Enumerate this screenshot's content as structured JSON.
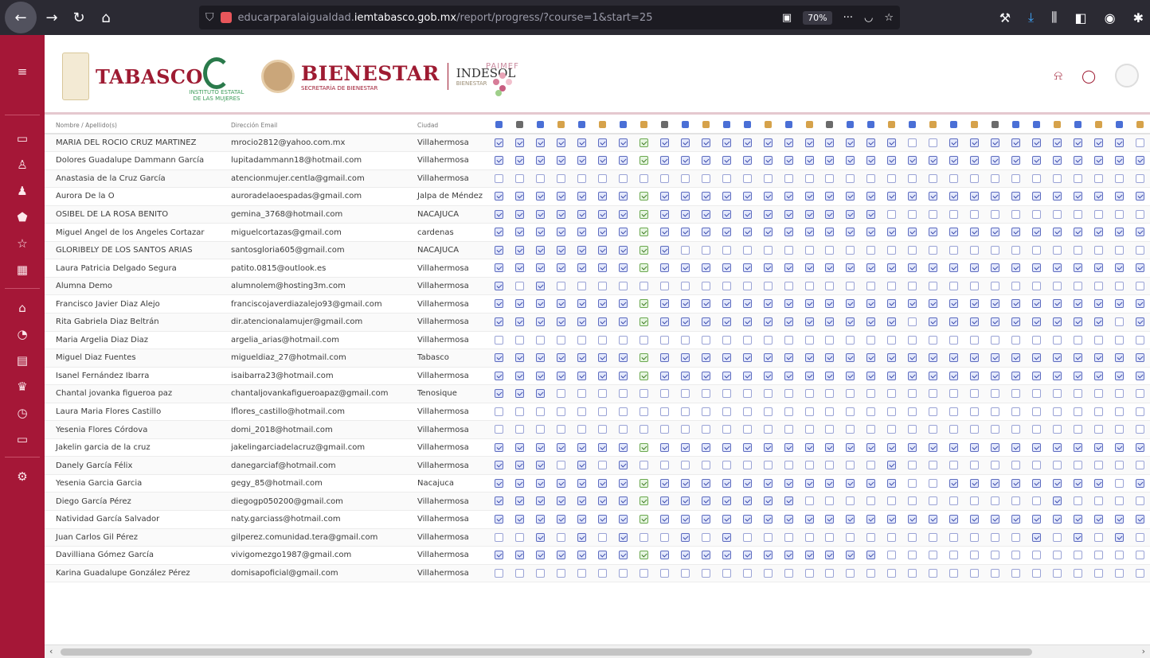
{
  "browser": {
    "url_prefix": "educarparalaigualdad.",
    "url_domain": "iemtabasco.gob.mx",
    "url_path": "/report/progress/?course=1&start=25",
    "zoom": "70%",
    "icons": [
      "back-icon",
      "forward-icon",
      "reload-icon",
      "home-icon",
      "shield-icon",
      "reader-icon",
      "more-icon",
      "pocket-icon",
      "star-icon",
      "wrench-icon",
      "download-icon",
      "library-icon",
      "sidebar-icon",
      "account-icon",
      "extension-icon"
    ]
  },
  "sidebar": {
    "icons": [
      "menu-icon",
      "folder-icon",
      "users-icon",
      "user-icon",
      "shield-icon",
      "star-icon",
      "calendar-icon",
      "home-icon",
      "dashboard-icon",
      "grid-icon",
      "badge-icon",
      "chart-icon",
      "folder-icon",
      "settings-icon"
    ]
  },
  "header": {
    "logo_tabasco": "TABASCO",
    "logo_iem_sub": "INSTITUTO ESTATAL DE LAS MUJERES",
    "logo_bienestar": "BIENESTAR",
    "logo_bienestar_sub": "SECRETARÍA DE BIENESTAR",
    "logo_indesol": "INDESOL",
    "logo_indesol_sub": "BIENESTAR",
    "logo_paimef": "PAIMEF",
    "actions": [
      "bell-icon",
      "chat-icon",
      "avatar"
    ]
  },
  "table": {
    "columns": {
      "name": "Nombre / Apellido(s)",
      "email": "Dirección Email",
      "city": "Ciudad"
    },
    "rows": [
      {
        "name": "MARIA DEL ROCIO CRUZ MARTINEZ",
        "email": "mrocio2812@yahoo.com.mx",
        "city": "Villahermosa",
        "p": "111111111111111111110011111111101111110"
      },
      {
        "name": "Dolores Guadalupe Dammann García",
        "email": "lupitadammann18@hotmail.com",
        "city": "Villahermosa",
        "p": "111111111111111111111111111111111111110"
      },
      {
        "name": "Anastasia de la Cruz García",
        "email": "atencionmujer.centla@gmail.com",
        "city": "Villahermosa",
        "p": "000000000000000000000000000000000000000"
      },
      {
        "name": "Aurora De la O",
        "email": "auroradelaoespadas@gmail.com",
        "city": "Jalpa de Méndez",
        "p": "111111111111111111111111111111111111110"
      },
      {
        "name": "OSIBEL DE LA ROSA BENITO",
        "email": "gemina_3768@hotmail.com",
        "city": "NACAJUCA",
        "p": "111111111111111111100000000000000000000"
      },
      {
        "name": "Miguel Angel de los Angeles Cortazar",
        "email": "miguelcortazas@gmail.com",
        "city": "cardenas",
        "p": "111111111111111111111111111111111111110"
      },
      {
        "name": "GLORIBELY DE LOS SANTOS ARIAS",
        "email": "santosgloria605@gmail.com",
        "city": "NACAJUCA",
        "p": "111111111000000000000000000000000000000"
      },
      {
        "name": "Laura Patricia Delgado Segura",
        "email": "patito.0815@outlook.es",
        "city": "Villahermosa",
        "p": "111111111111111111111111111111111111110"
      },
      {
        "name": "Alumna Demo",
        "email": "alumnolem@hosting3m.com",
        "city": "Villahermosa",
        "p": "101000000000000000000000000000000000000"
      },
      {
        "name": "Francisco Javier Diaz Alejo",
        "email": "franciscojaverdiazalejo93@gmail.com",
        "city": "Villahermosa",
        "p": "111111111111111111111111111111111111110"
      },
      {
        "name": "Rita Gabriela Diaz Beltrán",
        "email": "dir.atencionalamujer@gmail.com",
        "city": "Villahermosa",
        "p": "111111111111111111110111111111011111110"
      },
      {
        "name": "Maria Argelia Diaz Diaz",
        "email": "argelia_arias@hotmail.com",
        "city": "Villahermosa",
        "p": "000000000000000000000000000000000000000"
      },
      {
        "name": "Miguel Diaz Fuentes",
        "email": "migueldiaz_27@hotmail.com",
        "city": "Tabasco",
        "p": "111111111111111111111111111111111111110"
      },
      {
        "name": "Isanel Fernández Ibarra",
        "email": "isaibarra23@hotmail.com",
        "city": "Villahermosa",
        "p": "111111111111111111111111111111111111110"
      },
      {
        "name": "Chantal jovanka figueroa paz",
        "email": "chantaljovankafigueroapaz@gmail.com",
        "city": "Tenosique",
        "p": "111000000000000000000000000000000000000"
      },
      {
        "name": "Laura Maria Flores Castillo",
        "email": "lflores_castillo@hotmail.com",
        "city": "Villahermosa",
        "p": "000000000000000000000000000000000000000"
      },
      {
        "name": "Yesenia Flores Córdova",
        "email": "domi_2018@hotmail.com",
        "city": "Villahermosa",
        "p": "000000000000000000000000000000000000000"
      },
      {
        "name": "Jakelin garcia de la cruz",
        "email": "jakelingarciadelacruz@gmail.com",
        "city": "Villahermosa",
        "p": "111111111111111111111111111111111111110"
      },
      {
        "name": "Danely García Félix",
        "email": "danegarciaf@hotmail.com",
        "city": "Villahermosa",
        "p": "111010100000000000010000000000000000000"
      },
      {
        "name": "Yesenia Garcia Garcia",
        "email": "gegy_85@hotmail.com",
        "city": "Nacajuca",
        "p": "111111111111111111110011111111010000000"
      },
      {
        "name": "Diego García Pérez",
        "email": "diegogp050200@gmail.com",
        "city": "Villahermosa",
        "p": "111111111111111000000000000100000000000"
      },
      {
        "name": "Natividad García Salvador",
        "email": "naty.garciass@hotmail.com",
        "city": "Villahermosa",
        "p": "111111111111111111111111111111111111110"
      },
      {
        "name": "Juan Carlos Gil Pérez",
        "email": "gilperez.comunidad.tera@gmail.com",
        "city": "Villahermosa",
        "p": "001010100101000000000000001010100000000"
      },
      {
        "name": "Davilliana Gómez García",
        "email": "vivigomezgo1987@gmail.com",
        "city": "Villahermosa",
        "p": "111111111111111111100000000000000000000"
      },
      {
        "name": "Karina Guadalupe González Pérez",
        "email": "domisapoficial@gmail.com",
        "city": "Villahermosa",
        "p": "000000000000000000000000000000000000000"
      }
    ],
    "activity_icon_colors": [
      "#4a6fd6",
      "#6b6b6b",
      "#4a6fd6",
      "#d6a24a",
      "#4a6fd6",
      "#d6a24a",
      "#4a6fd6",
      "#d6a24a",
      "#6b6b6b",
      "#4a6fd6",
      "#d6a24a",
      "#4a6fd6",
      "#4a6fd6",
      "#d6a24a",
      "#4a6fd6",
      "#d6a24a",
      "#6b6b6b",
      "#4a6fd6",
      "#4a6fd6",
      "#d6a24a",
      "#4a6fd6",
      "#d6a24a",
      "#4a6fd6",
      "#d6a24a",
      "#6b6b6b",
      "#4a6fd6",
      "#4a6fd6",
      "#d6a24a",
      "#4a6fd6",
      "#d6a24a",
      "#4a6fd6",
      "#d6a24a",
      "#6b6b6b",
      "#4a6fd6",
      "#4a6fd6",
      "#d6a24a",
      "#4a6fd6",
      "#4a6fd6",
      "#d6a24a"
    ],
    "green_column": 7
  },
  "colors": {
    "sidebar": "#a51737",
    "accent": "#9e1b32",
    "checkbox": "#5c6bc0"
  }
}
